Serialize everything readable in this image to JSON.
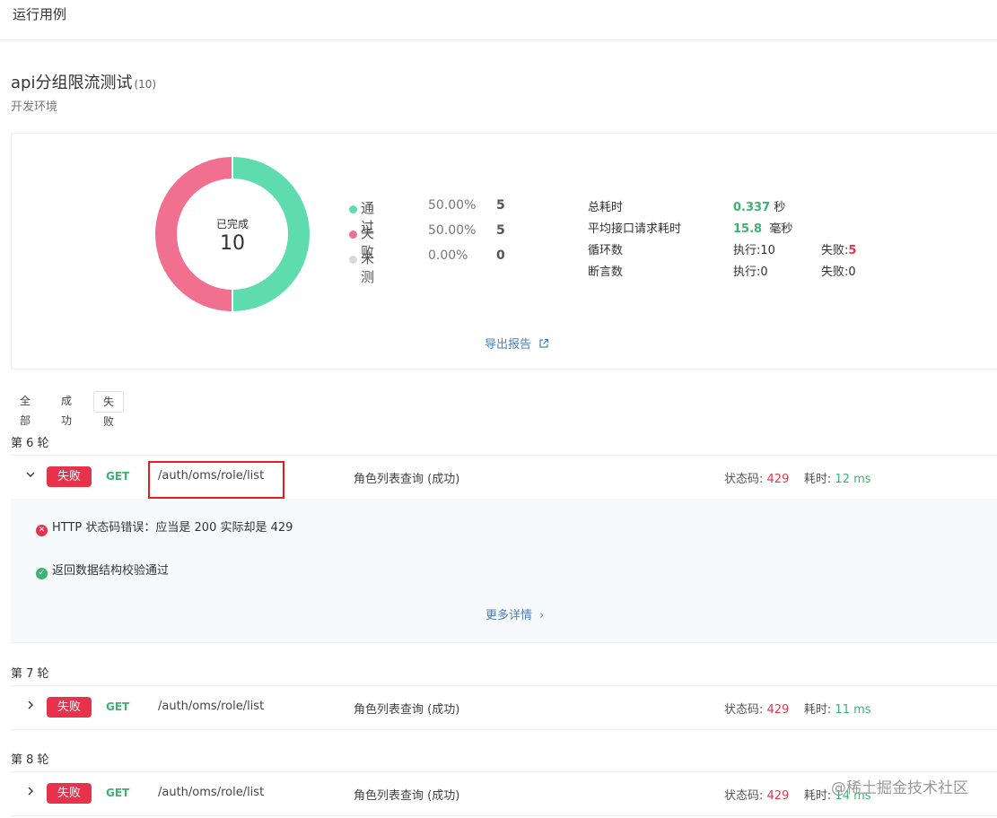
{
  "header": {
    "title": "运行用例"
  },
  "suite": {
    "name": "api分组限流测试",
    "count": "(10)",
    "env": "开发环境"
  },
  "summary": {
    "donut_caption": "已完成",
    "donut_total": "10",
    "legend": [
      {
        "name": "通过",
        "pct": "50.00%",
        "count": "5",
        "color": "#5fdcae"
      },
      {
        "name": "失败",
        "pct": "50.00%",
        "count": "5",
        "color": "#f2708f"
      },
      {
        "name": "未测",
        "pct": "0.00%",
        "count": "0",
        "color": "#d9d9d9"
      }
    ],
    "stats": {
      "total_time_label": "总耗时",
      "total_time_value": "0.337",
      "total_time_unit": "秒",
      "avg_time_label": "平均接口请求耗时",
      "avg_time_value": "15.8",
      "avg_time_unit": "毫秒",
      "loop_label": "循环数",
      "loop_exec": "执行:10",
      "loop_fail_label": "失败:",
      "loop_fail_value": "5",
      "assert_label": "断言数",
      "assert_exec": "执行:0",
      "assert_fail": "失败:0"
    },
    "export_label": "导出报告"
  },
  "filters": {
    "all": "全部",
    "success": "成功",
    "fail": "失败",
    "active": "失败"
  },
  "rounds": [
    {
      "label": "第 6 轮",
      "expanded": true,
      "status": "失败",
      "method": "GET",
      "path": "/auth/oms/role/list",
      "name": "角色列表查询 (成功)",
      "code_label": "状态码:",
      "code": "429",
      "time_label": "耗时:",
      "time": "12 ms",
      "assertions": [
        {
          "ok": false,
          "text": "HTTP 状态码错误：应当是 200 实际却是 429"
        },
        {
          "ok": true,
          "text": "返回数据结构校验通过"
        }
      ],
      "more_label": "更多详情"
    },
    {
      "label": "第 7 轮",
      "expanded": false,
      "status": "失败",
      "method": "GET",
      "path": "/auth/oms/role/list",
      "name": "角色列表查询 (成功)",
      "code_label": "状态码:",
      "code": "429",
      "time_label": "耗时:",
      "time": "11 ms"
    },
    {
      "label": "第 8 轮",
      "expanded": false,
      "status": "失败",
      "method": "GET",
      "path": "/auth/oms/role/list",
      "name": "角色列表查询 (成功)",
      "code_label": "状态码:",
      "code": "429",
      "time_label": "耗时:",
      "time": "14 ms"
    }
  ],
  "watermark": "@稀土掘金技术社区"
}
